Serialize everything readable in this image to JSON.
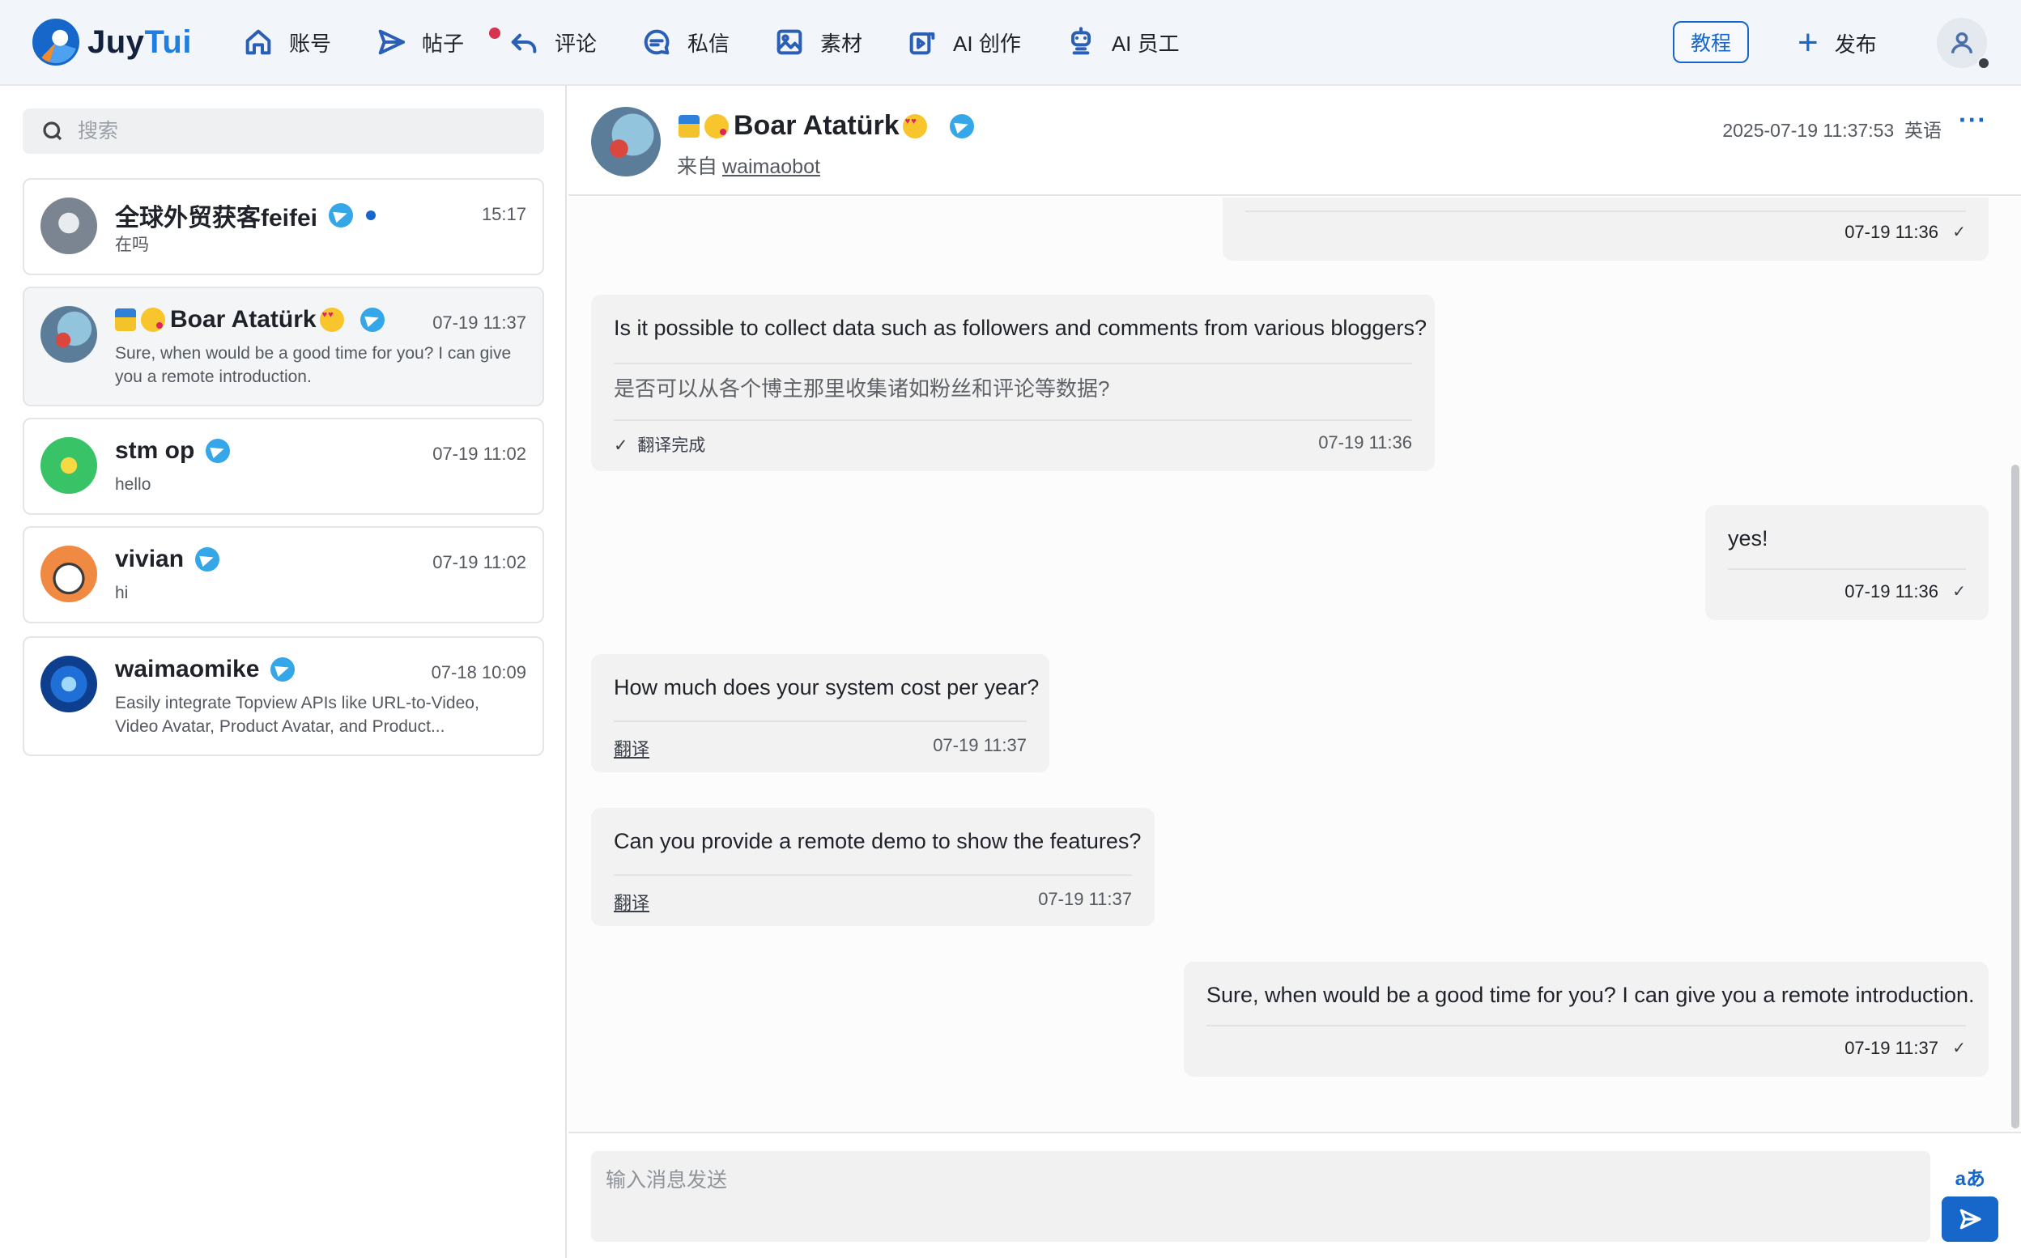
{
  "app": {
    "logo_part1": "Juy",
    "logo_part2": "Tui"
  },
  "nav": [
    {
      "label": "账号",
      "icon": "home-icon"
    },
    {
      "label": "帖子",
      "icon": "send-icon"
    },
    {
      "label": "评论",
      "icon": "reply-icon"
    },
    {
      "label": "私信",
      "icon": "chat-icon",
      "badge": true
    },
    {
      "label": "素材",
      "icon": "image-icon"
    },
    {
      "label": "AI 创作",
      "icon": "ai-create-icon"
    },
    {
      "label": "AI 员工",
      "icon": "robot-icon"
    }
  ],
  "topbar": {
    "tutorial_label": "教程",
    "publish_label": "发布"
  },
  "search": {
    "placeholder": "搜索"
  },
  "conversations": [
    {
      "name": "全球外贸获客feifei",
      "time": "15:17",
      "preview": "在吗",
      "unread": true
    },
    {
      "name": "Boar Atatürk",
      "time": "07-19 11:37",
      "preview": "Sure, when would be a good time for you? I can give you a remote introduction.",
      "active": true
    },
    {
      "name": "stm op",
      "time": "07-19 11:02",
      "preview": "hello"
    },
    {
      "name": "vivian",
      "time": "07-19 11:02",
      "preview": "hi"
    },
    {
      "name": "waimaomike",
      "time": "07-18 10:09",
      "preview": "Easily integrate Topview APIs like URL-to-Video, Video Avatar, Product Avatar, and Product..."
    }
  ],
  "chat": {
    "name": "Boar Atatürk",
    "from_prefix": "来自",
    "from_source": "waimaobot",
    "datetime": "2025-07-19 11:37:53",
    "language": "英语",
    "more": "···"
  },
  "messages": [
    {
      "side": "me",
      "time": "07-19 11:36",
      "check": "✓"
    },
    {
      "side": "them",
      "text": "Is it possible to collect data such as followers and comments from various bloggers?",
      "translation": "是否可以从各个博主那里收集诸如粉丝和评论等数据?",
      "status": "翻译完成",
      "time": "07-19 11:36"
    },
    {
      "side": "me",
      "text": "yes!",
      "time": "07-19 11:36",
      "check": "✓"
    },
    {
      "side": "them",
      "text": "How much does your system cost per year?",
      "action": "翻译",
      "time": "07-19 11:37"
    },
    {
      "side": "them",
      "text": "Can you provide a remote demo to show the features?",
      "action": "翻译",
      "time": "07-19 11:37"
    },
    {
      "side": "me",
      "text": "Sure, when would be a good time for you? I can give you a remote introduction.",
      "time": "07-19 11:37",
      "check": "✓"
    }
  ],
  "composer": {
    "placeholder": "输入消息发送",
    "translate_icon": "aあ"
  },
  "colors": {
    "accent": "#1766c9",
    "badge_red": "#d6334e",
    "telegram": "#35a6e8"
  }
}
